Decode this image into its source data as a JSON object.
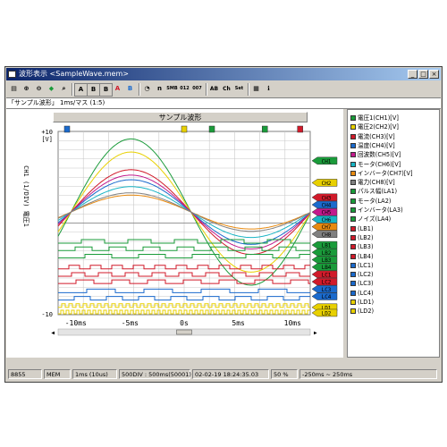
{
  "window": {
    "title": "波形表示 <SampleWave.mem>",
    "subtitle": "「サンプル波形」 1ms/マス (1:5)",
    "wave_title": "サンプル波形"
  },
  "toolbar": {
    "buttons": [
      "A",
      "B",
      "B",
      "A",
      "B",
      "n",
      "SMB",
      "012",
      "007",
      "AB",
      "Ch",
      "Set"
    ]
  },
  "axis": {
    "y_top": "+10",
    "y_unit": "[V]",
    "y_bottom": "-10",
    "y_label": "CH1 (1/DIV) 電圧1",
    "x_ticks": [
      "-10ms",
      "-5ms",
      "0s",
      "5ms",
      "10ms"
    ]
  },
  "markers": [
    "CH1",
    "CH2",
    "CH3",
    "CH4",
    "CH5",
    "CH6",
    "CH7",
    "CH8",
    "LB1",
    "LB2",
    "LB3",
    "LB4",
    "LC1",
    "LC2",
    "LC3",
    "LC4",
    "LD1",
    "LD2"
  ],
  "legend": {
    "items": [
      {
        "label": "電圧1(CH1)[V]",
        "color": "#1a9b3a"
      },
      {
        "label": "電圧2(CH2)[V]",
        "color": "#e8d000"
      },
      {
        "label": "電流(CH3)[V]",
        "color": "#d11a2a"
      },
      {
        "label": "温度(CH4)[V]",
        "color": "#1a6acd"
      },
      {
        "label": "回波数(CH5)[V]",
        "color": "#c21a8c"
      },
      {
        "label": "モータ(CH6)[V]",
        "color": "#18b4c4"
      },
      {
        "label": "インバータ(CH7)[V]",
        "color": "#e88a10"
      },
      {
        "label": "電力(CH8)[V]",
        "color": "#808080"
      },
      {
        "label": "パルス幅(LA1)",
        "color": "#1a9b3a"
      },
      {
        "label": "モータ(LA2)",
        "color": "#1a9b3a"
      },
      {
        "label": "インバータ(LA3)",
        "color": "#1a9b3a"
      },
      {
        "label": "ノイズ(LA4)",
        "color": "#1a9b3a"
      },
      {
        "label": "(LB1)",
        "color": "#d11a2a"
      },
      {
        "label": "(LB2)",
        "color": "#d11a2a"
      },
      {
        "label": "(LB3)",
        "color": "#d11a2a"
      },
      {
        "label": "(LB4)",
        "color": "#d11a2a"
      },
      {
        "label": "(LC1)",
        "color": "#1a6acd"
      },
      {
        "label": "(LC2)",
        "color": "#1a6acd"
      },
      {
        "label": "(LC3)",
        "color": "#1a6acd"
      },
      {
        "label": "(LC4)",
        "color": "#1a6acd"
      },
      {
        "label": "(LD1)",
        "color": "#e8d000"
      },
      {
        "label": "(LD2)",
        "color": "#e8d000"
      }
    ]
  },
  "status": {
    "model": "8855",
    "mode": "MEM",
    "timebase": "1ms (10us)",
    "div": "500DIV : 500ms(50001)",
    "trigger_time": "02-02-19 18:24:35.03",
    "trig_pos": "50 %",
    "range": "-250ms ~ 250ms"
  }
}
